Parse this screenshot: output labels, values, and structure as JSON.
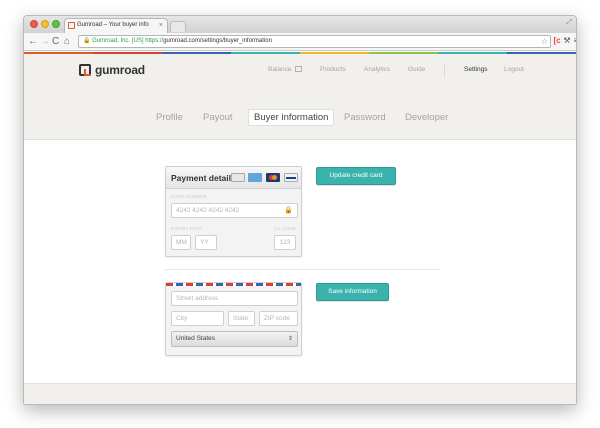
{
  "browser": {
    "tab_title": "Gumroad – Your buyer info",
    "tab_close": "×",
    "resize_glyph": "⤢",
    "nav": {
      "back": "←",
      "forward": "→",
      "reload": "C",
      "home": "⌂"
    },
    "address": {
      "lock": "🔒",
      "ev": "Gumroad, Inc. [US]",
      "scheme": "https://",
      "rest": "gumroad.com/settings/buyer_information"
    },
    "star": "☆",
    "menu_glyph": "≡",
    "wrench_glyph": "⚒",
    "ext_glyph": "[c"
  },
  "brand": {
    "logo_text": "gumroad"
  },
  "topnav": {
    "balance": "Balance",
    "products": "Products",
    "analytics": "Analytics",
    "guide": "Guide",
    "settings": "Settings",
    "logout": "Logout"
  },
  "subnav": {
    "profile": "Profile",
    "payout": "Payout",
    "buyer": "Buyer information",
    "password": "Password",
    "developer": "Developer"
  },
  "payment": {
    "title": "Payment details",
    "card_number_label": "CARD NUMBER",
    "card_number_placeholder": "4242 4242 4242 4242",
    "lock_glyph": "🔒",
    "expiry_label": "EXPIRY DATE",
    "cvc_label": "CV CODE",
    "mm_placeholder": "MM",
    "yy_placeholder": "YY",
    "cvc_placeholder": "123",
    "update_button": "Update credit card"
  },
  "address": {
    "street_placeholder": "Street address",
    "city_placeholder": "City",
    "state_placeholder": "State",
    "zip_placeholder": "ZIP code",
    "country": "United States",
    "select_arrow": "⇕",
    "save_button": "Save information"
  },
  "colors": {
    "accent": "#3bb3ad",
    "stripes": [
      "#e05b2b",
      "#d8403a",
      "#3b64b0",
      "#3bb3ad",
      "#f1b52a",
      "#8cc152"
    ]
  }
}
